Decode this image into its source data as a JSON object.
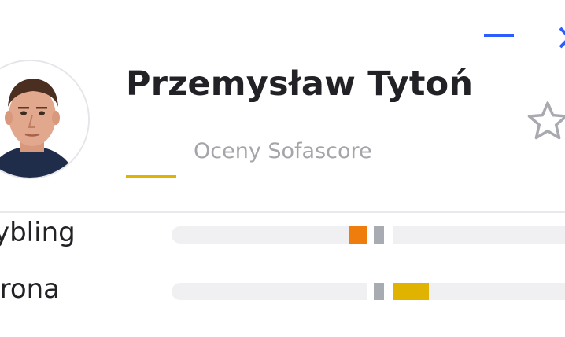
{
  "player": {
    "name": "Przemysław Tytoń"
  },
  "tabs": [
    {
      "label": "Oceny Sofascore",
      "active": true
    }
  ],
  "window": {
    "minimize_icon": "minus-icon",
    "close_icon": "close-icon",
    "favorite_icon": "star-outline-icon"
  },
  "colors": {
    "accent_blue": "#2d5dff",
    "tab_underline": "#e0b300",
    "bar_orange": "#ef7d0d",
    "bar_gold": "#e0b300",
    "bar_neutral": "#a9abb2",
    "track": "#f0f0f3"
  },
  "stats": [
    {
      "label": "rybling",
      "bar_side": "left",
      "bar_color": "#ef7d0d",
      "bar_fraction": 0.09
    },
    {
      "label": "brona",
      "bar_side": "right",
      "bar_color": "#e0b300",
      "bar_fraction": 0.19
    }
  ]
}
